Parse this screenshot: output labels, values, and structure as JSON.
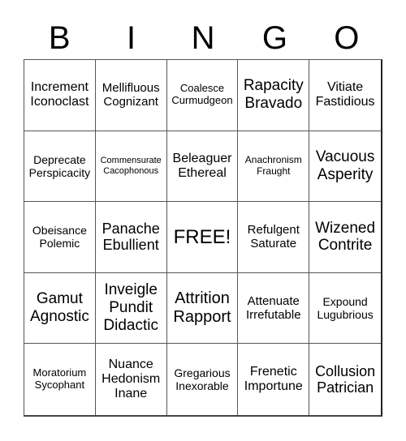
{
  "header": [
    "B",
    "I",
    "N",
    "G",
    "O"
  ],
  "cells": [
    [
      "Increment\nIconoclast",
      "Mellifluous\nCognizant",
      "Coalesce\nCurmudgeon",
      "Rapacity\nBravado",
      "Vitiate\nFastidious"
    ],
    [
      "Deprecate\nPerspicacity",
      "Commensurate\nCacophonous",
      "Beleaguer\nEthereal",
      "Anachronism\nFraught",
      "Vacuous\nAsperity"
    ],
    [
      "Obeisance\nPolemic",
      "Panache\nEbullient",
      "FREE!",
      "Refulgent\nSaturate",
      "Wizened\nContrite"
    ],
    [
      "Gamut\nAgnostic",
      "Inveigle\nPundit\nDidactic",
      "Attrition\nRapport",
      "Attenuate\nIrrefutable",
      "Expound\nLugubrious"
    ],
    [
      "Moratorium\nSycophant",
      "Nuance\nHedonism\nInane",
      "Gregarious\nInexorable",
      "Frenetic\nImportune",
      "Collusion\nPatrician"
    ]
  ]
}
